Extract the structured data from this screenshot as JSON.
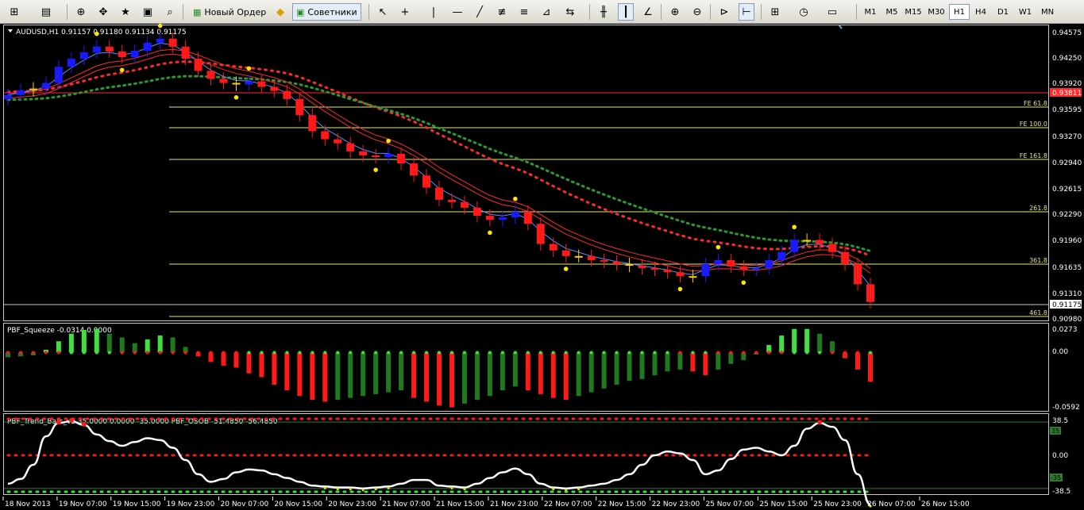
{
  "toolbar": {
    "new_order_label": "Новый Ордер",
    "advisors_label": "Советники",
    "timeframes": [
      "M1",
      "M5",
      "M15",
      "M30",
      "H1",
      "H4",
      "D1",
      "W1",
      "MN"
    ],
    "active_timeframe": "H1"
  },
  "main": {
    "title": "AUDUSD,H1  0.91157 0.91180 0.91134 0.91175",
    "price_labels": [
      "0.94575",
      "0.94250",
      "0.93920",
      "0.93595",
      "0.93270",
      "0.92940",
      "0.92615",
      "0.92290",
      "0.91960",
      "0.91635",
      "0.91310",
      "0.90980"
    ],
    "current_price": "0.91175",
    "red_line_price": "0.93811",
    "fib_labels": [
      "FE 61.8",
      "FE 100.0",
      "FE 161.8",
      "261.8",
      "361.8",
      "461.8"
    ]
  },
  "squeeze": {
    "title": "PBF_Squeeze -0.0314 0.0000",
    "labels": [
      "0.0273",
      "0.00",
      "-0.0592"
    ]
  },
  "trend": {
    "title": "PBF_Trend_Bars_v2 35.0000 0.0000 -35.0000  PBF_OSOB -51.4850 -56.4850",
    "labels": [
      "38.5",
      "0.00",
      "-38.5"
    ],
    "level_tags": [
      "35",
      "-35"
    ]
  },
  "time_axis": [
    "18 Nov 2013",
    "19 Nov 07:00",
    "19 Nov 15:00",
    "19 Nov 23:00",
    "20 Nov 07:00",
    "20 Nov 15:00",
    "20 Nov 23:00",
    "21 Nov 07:00",
    "21 Nov 15:00",
    "21 Nov 23:00",
    "22 Nov 07:00",
    "22 Nov 15:00",
    "22 Nov 23:00",
    "25 Nov 07:00",
    "25 Nov 15:00",
    "25 Nov 23:00",
    "26 Nov 07:00",
    "26 Nov 15:00"
  ],
  "colors": {
    "bull": "#1a1aff",
    "bear": "#ff1a1a",
    "neutral": "#ffd000",
    "fib": "#e6e67a",
    "grid_text": "#ffffff"
  },
  "chart_data": {
    "type": "candlestick",
    "symbol": "AUDUSD",
    "timeframe": "H1",
    "close": [
      0.9375,
      0.9381,
      0.9383,
      0.939,
      0.941,
      0.942,
      0.9428,
      0.9435,
      0.9429,
      0.9422,
      0.943,
      0.944,
      0.9445,
      0.9435,
      0.942,
      0.9405,
      0.9395,
      0.939,
      0.9388,
      0.9392,
      0.9385,
      0.938,
      0.937,
      0.935,
      0.933,
      0.932,
      0.9315,
      0.9305,
      0.93,
      0.9298,
      0.9302,
      0.929,
      0.9275,
      0.926,
      0.9245,
      0.9242,
      0.9235,
      0.9225,
      0.922,
      0.9223,
      0.923,
      0.9215,
      0.919,
      0.9182,
      0.9175,
      0.9175,
      0.917,
      0.9168,
      0.9165,
      0.9163,
      0.916,
      0.9158,
      0.9155,
      0.915,
      0.915,
      0.9165,
      0.917,
      0.9162,
      0.9158,
      0.916,
      0.917,
      0.918,
      0.9195,
      0.9195,
      0.919,
      0.918,
      0.9165,
      0.914,
      0.9118
    ],
    "squeeze_hist": [
      -0.005,
      -0.004,
      -0.003,
      0.003,
      0.012,
      0.02,
      0.024,
      0.025,
      0.02,
      0.016,
      0.01,
      0.014,
      0.018,
      0.016,
      0.006,
      -0.004,
      -0.01,
      -0.014,
      -0.016,
      -0.022,
      -0.026,
      -0.034,
      -0.04,
      -0.046,
      -0.05,
      -0.052,
      -0.05,
      -0.048,
      -0.046,
      -0.044,
      -0.042,
      -0.04,
      -0.048,
      -0.052,
      -0.056,
      -0.058,
      -0.054,
      -0.05,
      -0.046,
      -0.04,
      -0.036,
      -0.04,
      -0.044,
      -0.048,
      -0.05,
      -0.046,
      -0.042,
      -0.038,
      -0.034,
      -0.03,
      -0.028,
      -0.024,
      -0.02,
      -0.018,
      -0.02,
      -0.024,
      -0.018,
      -0.012,
      -0.008,
      -0.002,
      0.008,
      0.018,
      0.025,
      0.025,
      0.02,
      0.012,
      -0.006,
      -0.018,
      -0.031
    ],
    "trend_osc": [
      -30,
      -25,
      -10,
      20,
      34,
      36,
      32,
      22,
      15,
      10,
      14,
      18,
      16,
      8,
      -5,
      -20,
      -28,
      -25,
      -18,
      -15,
      -16,
      -20,
      -24,
      -28,
      -32,
      -33,
      -34,
      -34,
      -35,
      -34,
      -33,
      -30,
      -26,
      -26,
      -32,
      -33,
      -34,
      -30,
      -24,
      -18,
      -14,
      -20,
      -30,
      -34,
      -35,
      -34,
      -32,
      -30,
      -26,
      -20,
      -10,
      0,
      4,
      2,
      -5,
      -20,
      -16,
      -4,
      6,
      8,
      4,
      0,
      10,
      28,
      34,
      30,
      16,
      -20,
      -52
    ],
    "squeeze_ylim": [
      -0.0592,
      0.0273
    ],
    "trend_ylim": [
      -38.5,
      38.5
    ],
    "price_ylim": [
      0.9098,
      0.94575
    ]
  }
}
